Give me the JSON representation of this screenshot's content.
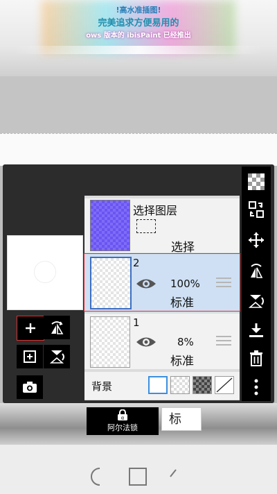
{
  "promo": {
    "line1": "!高水准插图!",
    "line2": "完美追求方便易用的",
    "line3": "ows 版本的 ibisPaint 已经推出"
  },
  "layers_panel": {
    "selection_layer": {
      "title": "选择图层",
      "label": "选择"
    },
    "layers": [
      {
        "number": "2",
        "opacity": "100%",
        "blend_mode": "标准",
        "selected": true
      },
      {
        "number": "1",
        "opacity": "8%",
        "blend_mode": "标准",
        "selected": false
      }
    ],
    "background": {
      "label": "背景",
      "options": [
        "white",
        "transparent-light",
        "transparent-dark",
        "none"
      ],
      "selected": "white"
    }
  },
  "left_tools": [
    "add-layer",
    "flip-horizontal",
    "add-folder",
    "flip-vertical",
    "camera"
  ],
  "right_tools": [
    "transparency",
    "layer-transfer",
    "move",
    "flip-horizontal",
    "flip-vertical",
    "merge-down",
    "delete",
    "more"
  ],
  "bottom_bar": {
    "alpha_lock_label": "阿尔法锁",
    "blend_button_label": "标"
  },
  "colors": {
    "highlight_red": "#e03030",
    "selected_row": "#cfe0f4",
    "selection_purple": "#6a55f2"
  }
}
